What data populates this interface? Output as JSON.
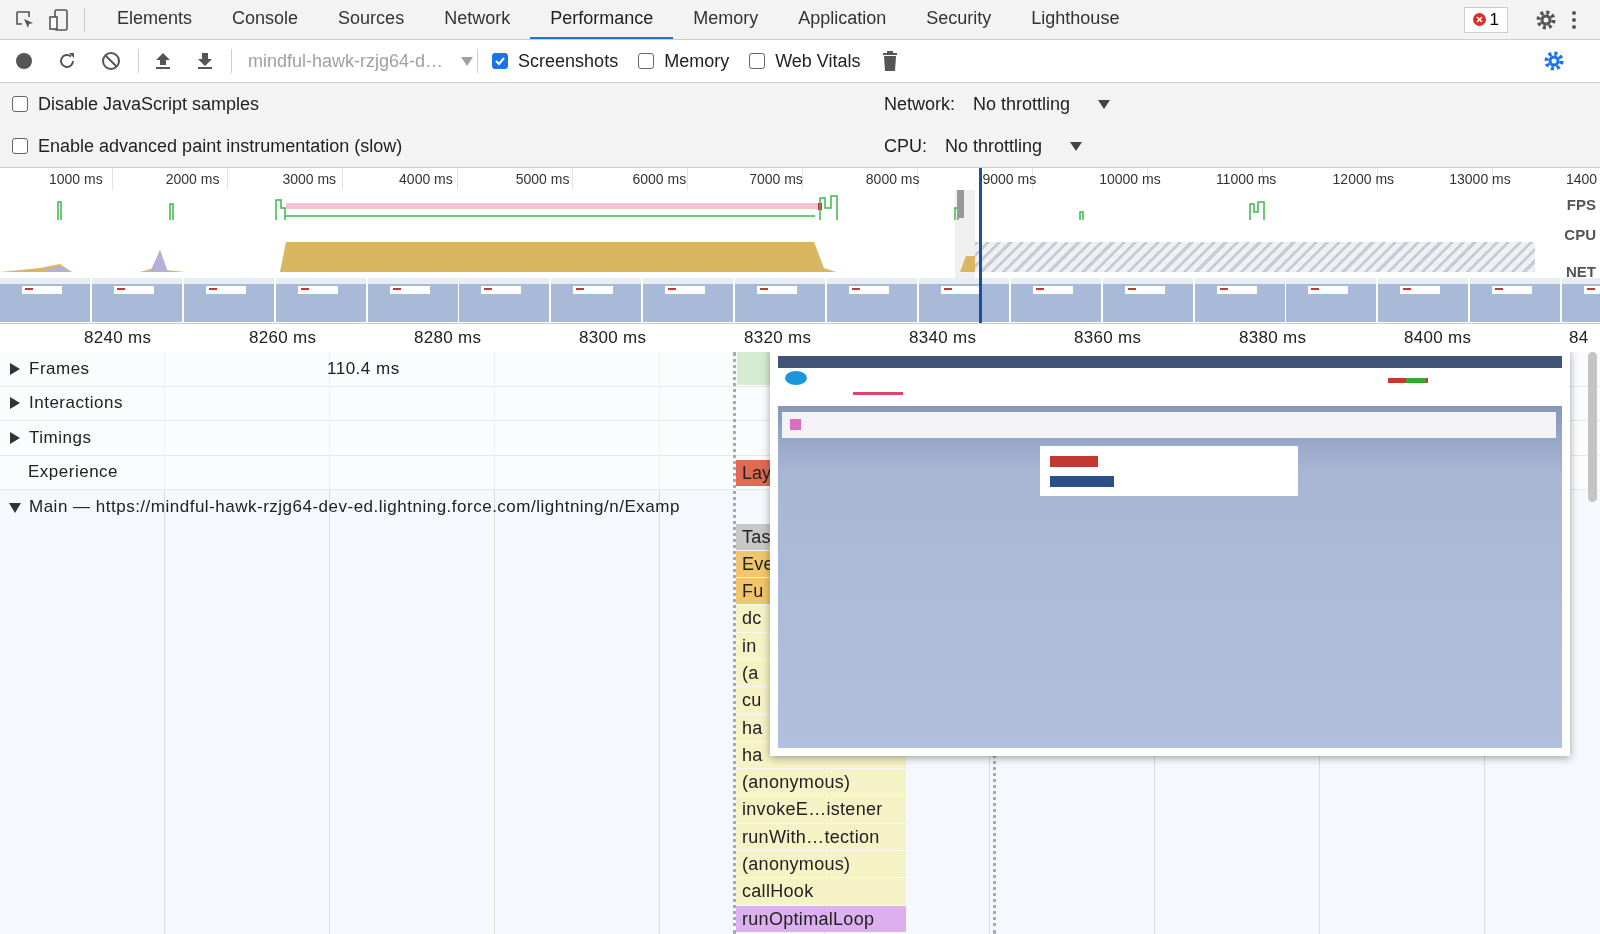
{
  "tabs": [
    {
      "label": "Elements",
      "selected": false
    },
    {
      "label": "Console",
      "selected": false
    },
    {
      "label": "Sources",
      "selected": false
    },
    {
      "label": "Network",
      "selected": false
    },
    {
      "label": "Performance",
      "selected": true
    },
    {
      "label": "Memory",
      "selected": false
    },
    {
      "label": "Application",
      "selected": false
    },
    {
      "label": "Security",
      "selected": false
    },
    {
      "label": "Lighthouse",
      "selected": false
    }
  ],
  "error_count": "1",
  "toolbar": {
    "profile": {
      "value": "mindful-hawk-rzjg64-d…",
      "disabled": true
    },
    "checkboxes": [
      {
        "label": "Screenshots",
        "checked": true
      },
      {
        "label": "Memory",
        "checked": false
      },
      {
        "label": "Web Vitals",
        "checked": false
      }
    ]
  },
  "settings": [
    {
      "label": "Disable JavaScript samples",
      "checked": false,
      "throttle_label": "Network:",
      "throttle_value": "No throttling"
    },
    {
      "label": "Enable advanced paint instrumentation (slow)",
      "checked": false,
      "throttle_label": "CPU:",
      "throttle_value": "No throttling"
    }
  ],
  "overview": {
    "ticks": [
      "1000 ms",
      "2000 ms",
      "3000 ms",
      "4000 ms",
      "5000 ms",
      "6000 ms",
      "7000 ms",
      "8000 ms",
      "9000 ms",
      "10000 ms",
      "11000 ms",
      "12000 ms",
      "13000 ms",
      "1400"
    ],
    "lanes": [
      "FPS",
      "CPU",
      "NET"
    ]
  },
  "ruler": [
    "8240 ms",
    "8260 ms",
    "8280 ms",
    "8300 ms",
    "8320 ms",
    "8340 ms",
    "8360 ms",
    "8380 ms",
    "8400 ms",
    "84"
  ],
  "tracks": [
    {
      "label": "Frames",
      "expanded": false,
      "kind": "frames",
      "value": "110.4 ms"
    },
    {
      "label": "Interactions",
      "expanded": false,
      "kind": "plain"
    },
    {
      "label": "Timings",
      "expanded": false,
      "kind": "plain"
    },
    {
      "label": "Experience",
      "kind": "experience",
      "block": "Lay"
    },
    {
      "label": "Main — https://mindful-hawk-rzjg64-dev-ed.lightning.force.com/lightning/n/Examp",
      "expanded": true,
      "kind": "main"
    }
  ],
  "flame": [
    {
      "label": "Tas",
      "kind": "task"
    },
    {
      "label": "Eve",
      "kind": "event"
    },
    {
      "label": "Fu",
      "kind": "event"
    },
    {
      "label": "dc",
      "kind": "call"
    },
    {
      "label": "in",
      "kind": "call"
    },
    {
      "label": "(a",
      "kind": "call"
    },
    {
      "label": "cu",
      "kind": "call"
    },
    {
      "label": "ha",
      "kind": "call"
    },
    {
      "label": "ha",
      "kind": "call"
    },
    {
      "label": "(anonymous)",
      "kind": "call"
    },
    {
      "label": "invokeE…istener",
      "kind": "call"
    },
    {
      "label": "runWith…tection",
      "kind": "call"
    },
    {
      "label": "(anonymous)",
      "kind": "call"
    },
    {
      "label": "callHook",
      "kind": "call"
    },
    {
      "label": "runOptimalLoop",
      "kind": "loop"
    }
  ]
}
